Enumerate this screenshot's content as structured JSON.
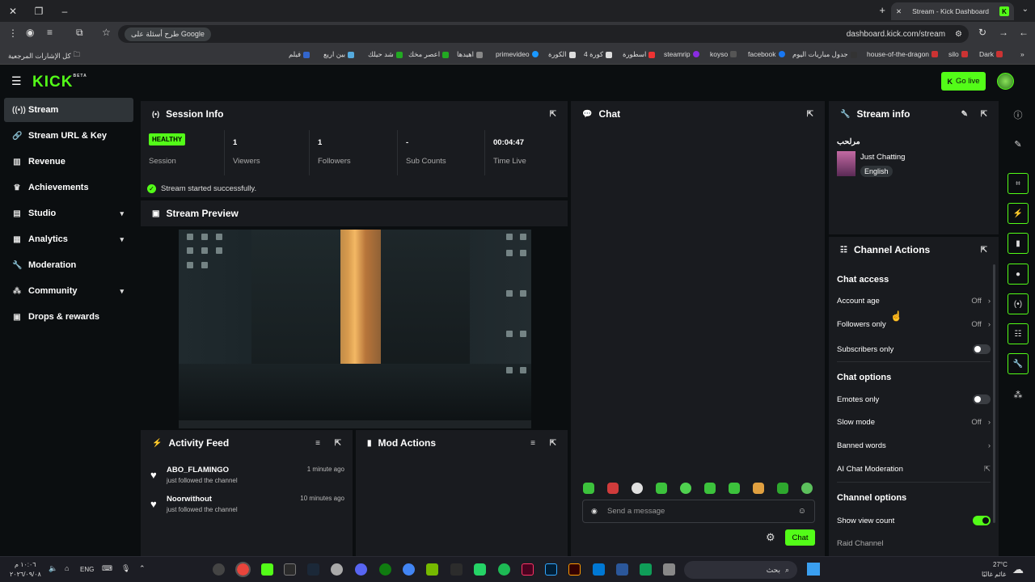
{
  "browser": {
    "tab_title": "Stream - Kick Dashboard",
    "url": "dashboard.kick.com/stream",
    "ask_google": "طرح أسئلة على Google",
    "bookmarks": [
      "Dark",
      "silo",
      "house-of-the-dragon",
      "جدول مباريات اليوم",
      "facebook",
      "koyso",
      "steamrip",
      "اسطورة",
      "كورة 4",
      "الكورة",
      "primevideo",
      "اهيدها",
      "اعصر مخك",
      "شد حيلك",
      "بين اريع",
      "فيلم"
    ],
    "all_bookmarks": "كل الإشارات المرجعية"
  },
  "nav": {
    "logo": "KICK",
    "logo_badge": "BETA",
    "go_live": "Go live"
  },
  "sidebar": {
    "items": [
      {
        "label": "Stream",
        "icon": "broadcast-icon"
      },
      {
        "label": "Stream URL & Key",
        "icon": "link-icon"
      },
      {
        "label": "Revenue",
        "icon": "chart-icon"
      },
      {
        "label": "Achievements",
        "icon": "trophy-icon"
      },
      {
        "label": "Studio",
        "icon": "studio-icon"
      },
      {
        "label": "Analytics",
        "icon": "analytics-icon"
      },
      {
        "label": "Moderation",
        "icon": "wrench-icon"
      },
      {
        "label": "Community",
        "icon": "community-icon"
      },
      {
        "label": "Drops & rewards",
        "icon": "gift-icon"
      }
    ]
  },
  "session": {
    "title": "Session Info",
    "status": "HEALTHY",
    "status_label": "Session",
    "viewers": "1",
    "viewers_label": "Viewers",
    "followers": "1",
    "followers_label": "Followers",
    "subs": "-",
    "subs_label": "Sub Counts",
    "time": "00:04:47",
    "time_label": "Time Live",
    "message": "Stream started successfully."
  },
  "preview": {
    "title": "Stream Preview"
  },
  "activity": {
    "title": "Activity Feed",
    "items": [
      {
        "name": "ABO_FLAMINGO",
        "sub": "just followed the channel",
        "time": "1 minute ago"
      },
      {
        "name": "Noorwithout",
        "sub": "just followed the channel",
        "time": "10 minutes ago"
      }
    ]
  },
  "mod_actions": {
    "title": "Mod Actions"
  },
  "chat": {
    "title": "Chat",
    "placeholder": "Send a message",
    "send": "Chat"
  },
  "stream_info": {
    "title": "Stream info",
    "stream_title": "مرلحب",
    "category": "Just Chatting",
    "language": "English"
  },
  "channel_actions": {
    "title": "Channel Actions",
    "chat_access": "Chat access",
    "account_age": "Account age",
    "account_age_val": "Off",
    "followers_only": "Followers only",
    "followers_only_val": "Off",
    "subscribers_only": "Subscribers only",
    "chat_options": "Chat options",
    "emotes_only": "Emotes only",
    "slow_mode": "Slow mode",
    "slow_mode_val": "Off",
    "banned_words": "Banned words",
    "ai_moderation": "AI Chat Moderation",
    "channel_options": "Channel options",
    "show_view_count": "Show view count",
    "raid_channel": "Raid Channel"
  },
  "taskbar": {
    "search": "بحث",
    "lang": "ENG",
    "time": "١٠:٠٦ م",
    "date": "٢٠٢٦/٠٩/٠٨",
    "temp": "27°C",
    "weather": "غائم غالبًا"
  }
}
